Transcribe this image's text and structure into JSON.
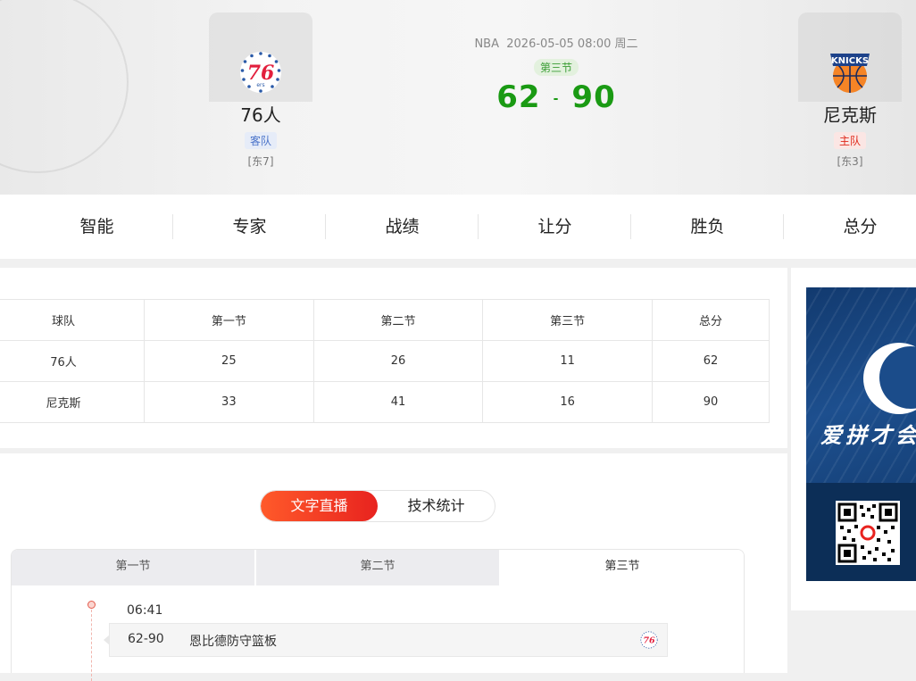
{
  "match": {
    "league": "NBA",
    "datetime": "2026-05-05 08:00",
    "weekday": "周二",
    "period": "第三节",
    "away_score": "62",
    "home_score": "90",
    "separator": "-"
  },
  "away_team": {
    "name": "76人",
    "role": "客队",
    "rank": "[东7]",
    "logo_icon": "76ers-logo-icon"
  },
  "home_team": {
    "name": "尼克斯",
    "role": "主队",
    "rank": "[东3]",
    "logo_icon": "knicks-logo-icon"
  },
  "nav": {
    "items": [
      {
        "label": "智能"
      },
      {
        "label": "专家"
      },
      {
        "label": "战绩"
      },
      {
        "label": "让分"
      },
      {
        "label": "胜负"
      },
      {
        "label": "总分"
      }
    ]
  },
  "quarter_table": {
    "headers": [
      "球队",
      "第一节",
      "第二节",
      "第三节",
      "总分"
    ],
    "rows": [
      [
        "76人",
        "25",
        "26",
        "11",
        "62"
      ],
      [
        "尼克斯",
        "33",
        "41",
        "16",
        "90"
      ]
    ]
  },
  "live": {
    "toggle": {
      "text_live": "文字直播",
      "stats": "技术统计",
      "active": "文字直播"
    },
    "quarter_tabs": [
      "第一节",
      "第二节",
      "第三节"
    ],
    "active_quarter": "第三节",
    "events": [
      {
        "time": "06:41",
        "score": "62-90",
        "text": "恩比德防守篮板",
        "team_icon": "76ers-logo-icon"
      }
    ]
  },
  "ad": {
    "slogan": "爱拼才会"
  },
  "colors": {
    "score_green": "#1a9a13",
    "accent_red": "#e8231f",
    "away_blue": "#4a73c9",
    "home_red": "#e02a1c"
  }
}
